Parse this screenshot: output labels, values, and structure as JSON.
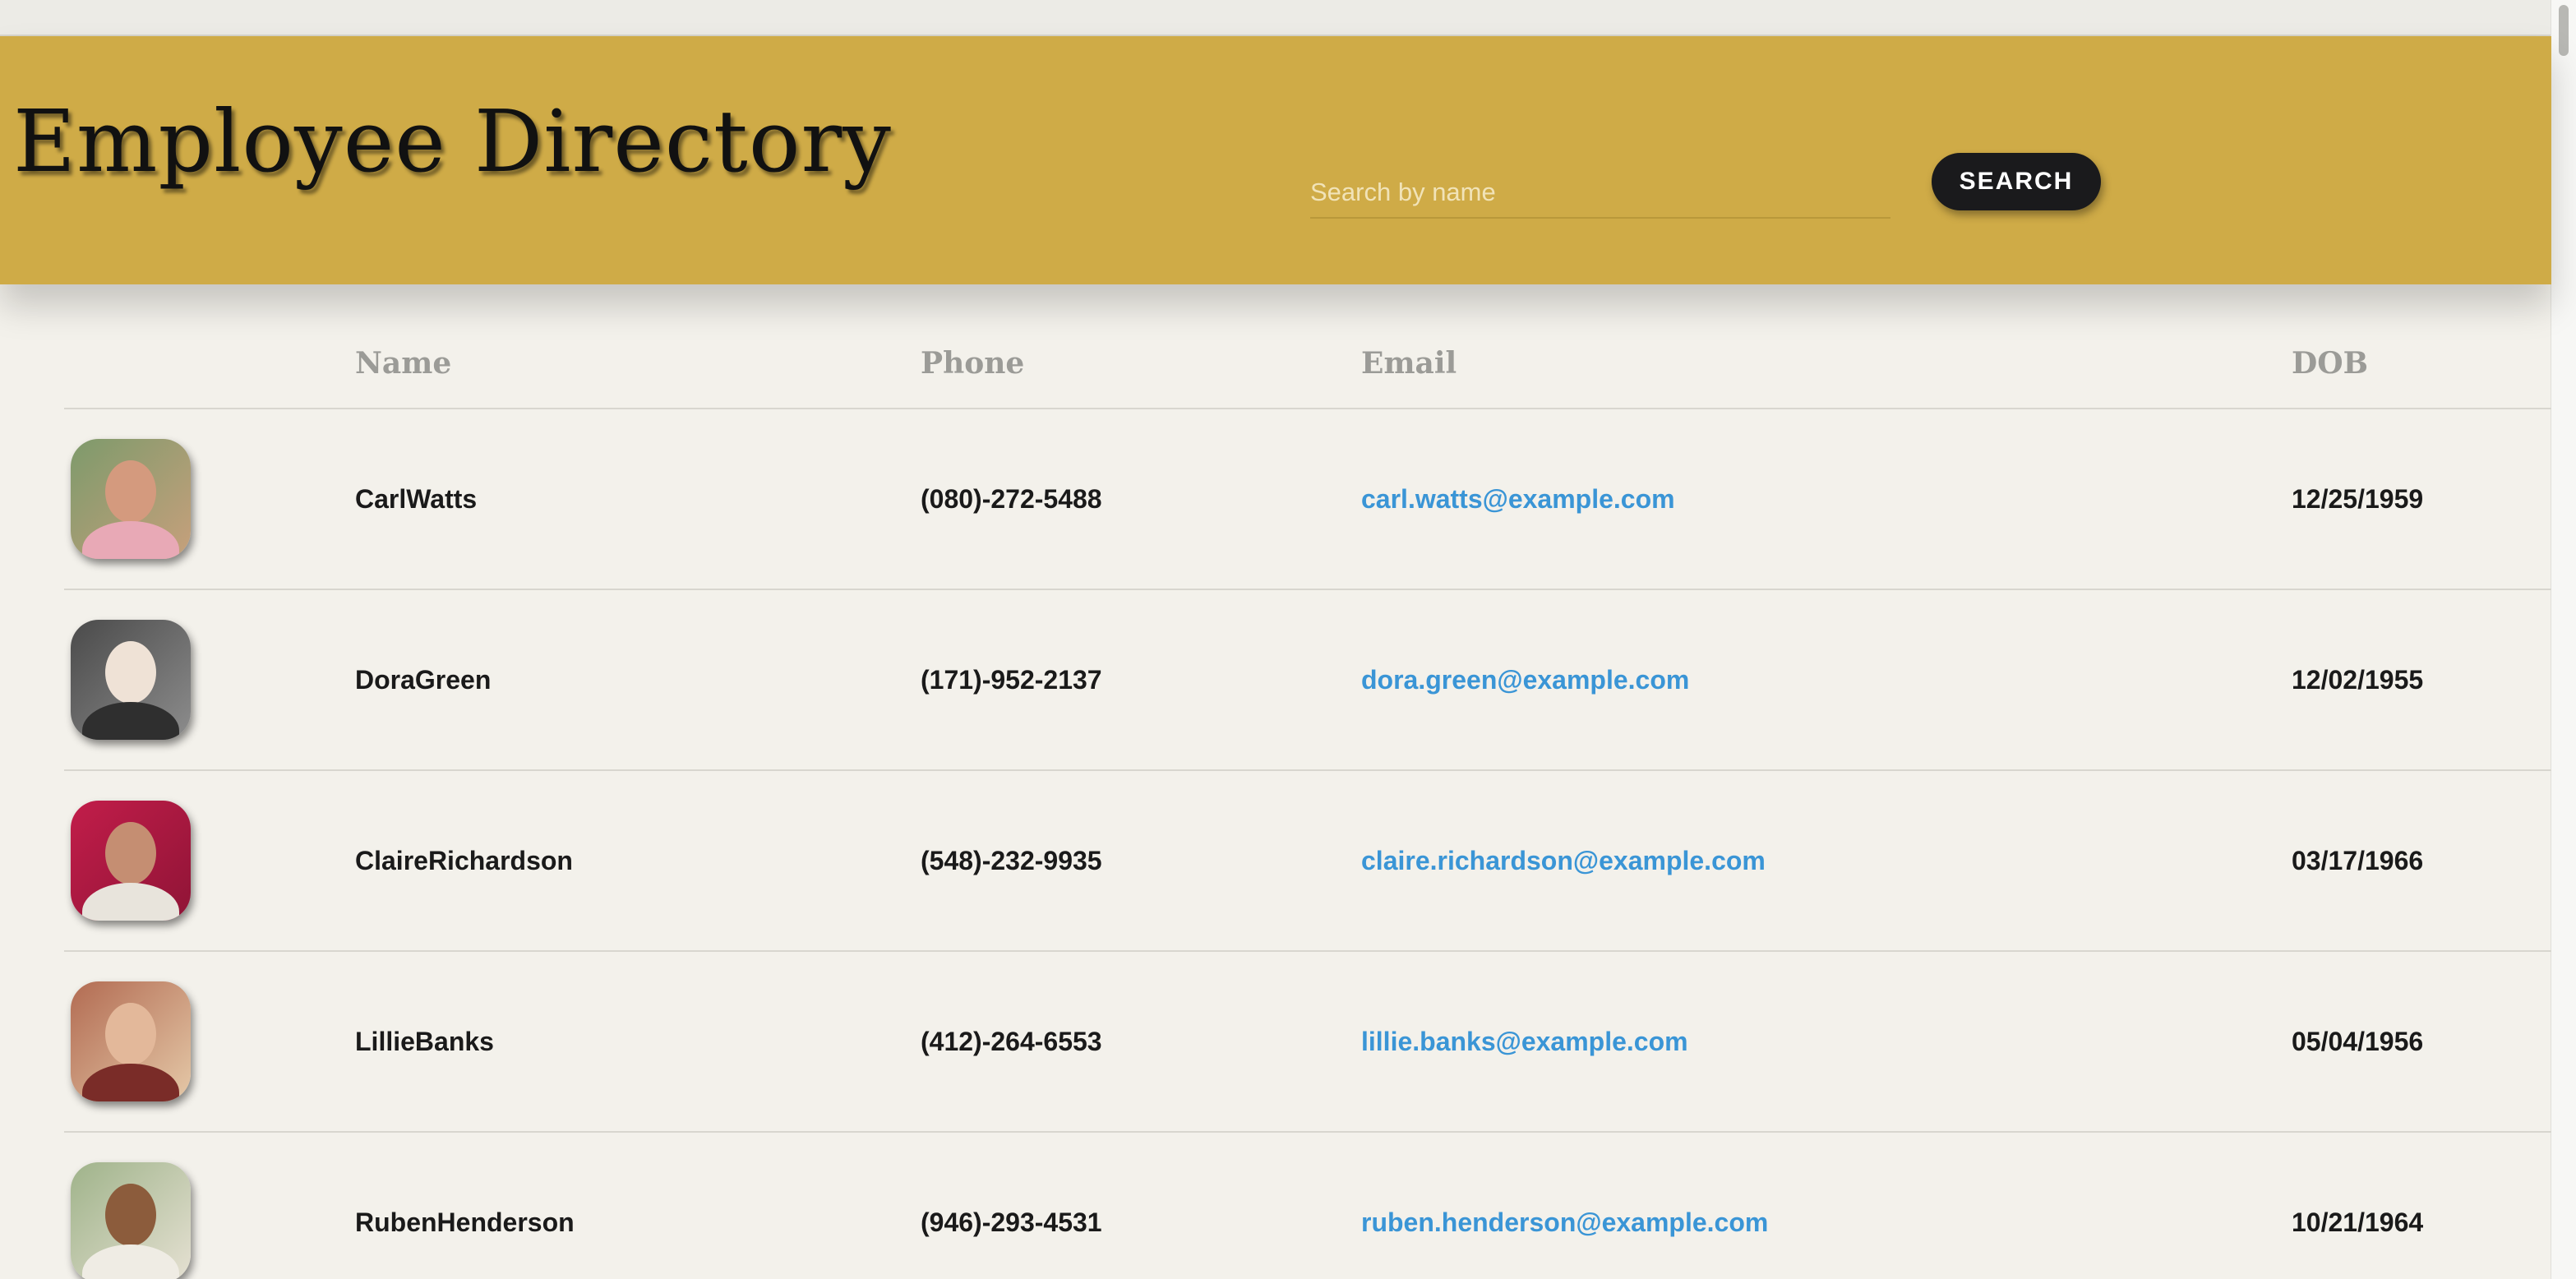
{
  "header": {
    "title": "Employee Directory",
    "search_placeholder": "Search by name",
    "search_value": "",
    "search_button_label": "SEARCH"
  },
  "colors": {
    "header_bg": "#cfab47",
    "page_bg": "#f3f1eb",
    "link": "#3a95d6",
    "button_bg": "#1a1a1c"
  },
  "table": {
    "columns": [
      "",
      "Name",
      "Phone",
      "Email",
      "DOB"
    ],
    "rows": [
      {
        "name": "CarlWatts",
        "phone": "(080)-272-5488",
        "email": "carl.watts@example.com",
        "dob": "12/25/1959",
        "avatar": "photo-of-carl-watts"
      },
      {
        "name": "DoraGreen",
        "phone": "(171)-952-2137",
        "email": "dora.green@example.com",
        "dob": "12/02/1955",
        "avatar": "photo-of-dora-green"
      },
      {
        "name": "ClaireRichardson",
        "phone": "(548)-232-9935",
        "email": "claire.richardson@example.com",
        "dob": "03/17/1966",
        "avatar": "photo-of-claire-richardson"
      },
      {
        "name": "LillieBanks",
        "phone": "(412)-264-6553",
        "email": "lillie.banks@example.com",
        "dob": "05/04/1956",
        "avatar": "photo-of-lillie-banks"
      },
      {
        "name": "RubenHenderson",
        "phone": "(946)-293-4531",
        "email": "ruben.henderson@example.com",
        "dob": "10/21/1964",
        "avatar": "photo-of-ruben-henderson"
      }
    ]
  }
}
